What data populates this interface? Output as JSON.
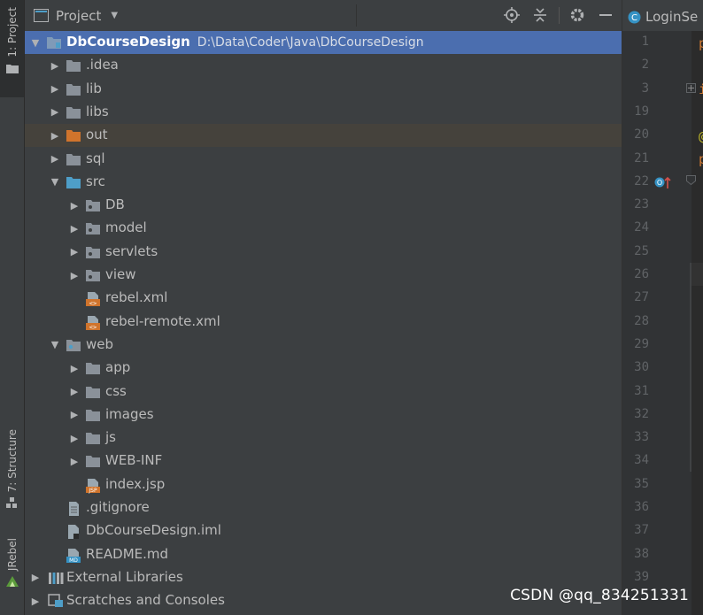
{
  "tool_stripe": {
    "project_tab": "1: Project",
    "structure_tab": "7: Structure",
    "jrebel_tab": "JRebel"
  },
  "panel": {
    "title": "Project",
    "icons": [
      "locate-icon",
      "collapse-all-icon",
      "gear-icon",
      "minimize-icon"
    ]
  },
  "tree": [
    {
      "label": "DbCourseDesign",
      "path": "D:\\Data\\Coder\\Java\\DbCourseDesign",
      "type": "module-folder",
      "expanded": true,
      "depth": 0,
      "selected": true
    },
    {
      "label": ".idea",
      "type": "folder",
      "expanded": false,
      "depth": 1
    },
    {
      "label": "lib",
      "type": "folder",
      "expanded": false,
      "depth": 1
    },
    {
      "label": "libs",
      "type": "folder",
      "expanded": false,
      "depth": 1
    },
    {
      "label": "out",
      "type": "excluded-folder",
      "expanded": false,
      "depth": 1,
      "hover": true
    },
    {
      "label": "sql",
      "type": "folder",
      "expanded": false,
      "depth": 1
    },
    {
      "label": "src",
      "type": "source-folder",
      "expanded": true,
      "depth": 1
    },
    {
      "label": "DB",
      "type": "package",
      "expanded": false,
      "depth": 2
    },
    {
      "label": "model",
      "type": "package",
      "expanded": false,
      "depth": 2
    },
    {
      "label": "servlets",
      "type": "package",
      "expanded": false,
      "depth": 2
    },
    {
      "label": "view",
      "type": "package",
      "expanded": false,
      "depth": 2
    },
    {
      "label": "rebel.xml",
      "type": "xml-file",
      "depth": 2
    },
    {
      "label": "rebel-remote.xml",
      "type": "xml-file",
      "depth": 2
    },
    {
      "label": "web",
      "type": "web-folder",
      "expanded": true,
      "depth": 1
    },
    {
      "label": "app",
      "type": "folder",
      "expanded": false,
      "depth": 2
    },
    {
      "label": "css",
      "type": "folder",
      "expanded": false,
      "depth": 2
    },
    {
      "label": "images",
      "type": "folder",
      "expanded": false,
      "depth": 2
    },
    {
      "label": "js",
      "type": "folder",
      "expanded": false,
      "depth": 2
    },
    {
      "label": "WEB-INF",
      "type": "folder",
      "expanded": false,
      "depth": 2
    },
    {
      "label": "index.jsp",
      "type": "jsp-file",
      "depth": 2
    },
    {
      "label": ".gitignore",
      "type": "text-file",
      "depth": 1
    },
    {
      "label": "DbCourseDesign.iml",
      "type": "iml-file",
      "depth": 1
    },
    {
      "label": "README.md",
      "type": "md-file",
      "depth": 1
    },
    {
      "label": "External Libraries",
      "type": "libraries",
      "expanded": false,
      "depth": 0
    },
    {
      "label": "Scratches and Consoles",
      "type": "scratches",
      "expanded": false,
      "depth": 0
    }
  ],
  "editor": {
    "tab_label": "LoginSe",
    "line_numbers": [
      "1",
      "2",
      "3",
      "19",
      "20",
      "21",
      "22",
      "23",
      "24",
      "25",
      "26",
      "27",
      "28",
      "29",
      "30",
      "31",
      "32",
      "33",
      "34",
      "35",
      "36",
      "37",
      "38",
      "39"
    ]
  },
  "watermark": "CSDN @qq_834251331",
  "colors": {
    "panel_bg": "#3c3f41",
    "selection": "#4b6eaf",
    "folder": "#8a9199",
    "source_folder": "#4e9ec8",
    "excluded_folder": "#d0742c",
    "editor_bg": "#2b2b2b"
  }
}
